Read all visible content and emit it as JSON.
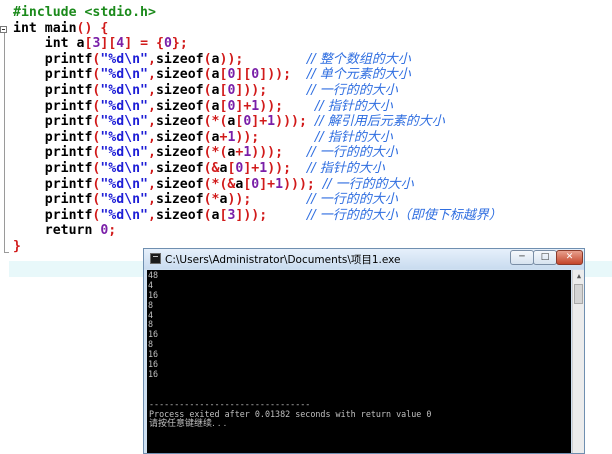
{
  "code_lines": [
    {
      "parts": [
        [
          "pp",
          "#include <stdio.h>"
        ]
      ]
    },
    {
      "parts": [
        [
          "kw",
          "int "
        ],
        [
          "fn",
          "main"
        ],
        [
          "sym",
          "() {"
        ]
      ]
    },
    {
      "parts": [
        [
          "kw",
          "    int "
        ],
        [
          "fn",
          "a"
        ],
        [
          "sym",
          "["
        ],
        [
          "num",
          "3"
        ],
        [
          "sym",
          "]["
        ],
        [
          "num",
          "4"
        ],
        [
          "sym",
          "] = {"
        ],
        [
          "num",
          "0"
        ],
        [
          "sym",
          "};"
        ]
      ]
    },
    {
      "parts": [
        [
          "fn",
          "    printf"
        ],
        [
          "sym",
          "("
        ],
        [
          "str",
          "\"%d\\n\""
        ],
        [
          "sym",
          ","
        ],
        [
          "kw",
          "sizeof"
        ],
        [
          "sym",
          "("
        ],
        [
          "fn",
          "a"
        ],
        [
          "sym",
          "));"
        ],
        [
          "fn",
          "        "
        ],
        [
          "cm",
          "// 整个数组的大小"
        ]
      ]
    },
    {
      "parts": [
        [
          "fn",
          "    printf"
        ],
        [
          "sym",
          "("
        ],
        [
          "str",
          "\"%d\\n\""
        ],
        [
          "sym",
          ","
        ],
        [
          "kw",
          "sizeof"
        ],
        [
          "sym",
          "("
        ],
        [
          "fn",
          "a"
        ],
        [
          "sym",
          "["
        ],
        [
          "num",
          "0"
        ],
        [
          "sym",
          "]["
        ],
        [
          "num",
          "0"
        ],
        [
          "sym",
          "]));"
        ],
        [
          "fn",
          "  "
        ],
        [
          "cm",
          "// 单个元素的大小"
        ]
      ]
    },
    {
      "parts": [
        [
          "fn",
          "    printf"
        ],
        [
          "sym",
          "("
        ],
        [
          "str",
          "\"%d\\n\""
        ],
        [
          "sym",
          ","
        ],
        [
          "kw",
          "sizeof"
        ],
        [
          "sym",
          "("
        ],
        [
          "fn",
          "a"
        ],
        [
          "sym",
          "["
        ],
        [
          "num",
          "0"
        ],
        [
          "sym",
          "]));"
        ],
        [
          "fn",
          "     "
        ],
        [
          "cm",
          "// 一行的的大小"
        ]
      ]
    },
    {
      "parts": [
        [
          "fn",
          "    printf"
        ],
        [
          "sym",
          "("
        ],
        [
          "str",
          "\"%d\\n\""
        ],
        [
          "sym",
          ","
        ],
        [
          "kw",
          "sizeof"
        ],
        [
          "sym",
          "("
        ],
        [
          "fn",
          "a"
        ],
        [
          "sym",
          "["
        ],
        [
          "num",
          "0"
        ],
        [
          "sym",
          "]+"
        ],
        [
          "num",
          "1"
        ],
        [
          "sym",
          "));"
        ],
        [
          "fn",
          "    "
        ],
        [
          "cm",
          "// 指针的大小"
        ]
      ]
    },
    {
      "parts": [
        [
          "fn",
          "    printf"
        ],
        [
          "sym",
          "("
        ],
        [
          "str",
          "\"%d\\n\""
        ],
        [
          "sym",
          ","
        ],
        [
          "kw",
          "sizeof"
        ],
        [
          "sym",
          "(*("
        ],
        [
          "fn",
          "a"
        ],
        [
          "sym",
          "["
        ],
        [
          "num",
          "0"
        ],
        [
          "sym",
          "]+"
        ],
        [
          "num",
          "1"
        ],
        [
          "sym",
          ")));"
        ],
        [
          "fn",
          " "
        ],
        [
          "cm",
          "// 解引用后元素的大小"
        ]
      ]
    },
    {
      "parts": [
        [
          "fn",
          "    printf"
        ],
        [
          "sym",
          "("
        ],
        [
          "str",
          "\"%d\\n\""
        ],
        [
          "sym",
          ","
        ],
        [
          "kw",
          "sizeof"
        ],
        [
          "sym",
          "("
        ],
        [
          "fn",
          "a"
        ],
        [
          "sym",
          "+"
        ],
        [
          "num",
          "1"
        ],
        [
          "sym",
          "));"
        ],
        [
          "fn",
          "       "
        ],
        [
          "cm",
          "// 指针的大小"
        ]
      ]
    },
    {
      "parts": [
        [
          "fn",
          "    printf"
        ],
        [
          "sym",
          "("
        ],
        [
          "str",
          "\"%d\\n\""
        ],
        [
          "sym",
          ","
        ],
        [
          "kw",
          "sizeof"
        ],
        [
          "sym",
          "(*("
        ],
        [
          "fn",
          "a"
        ],
        [
          "sym",
          "+"
        ],
        [
          "num",
          "1"
        ],
        [
          "sym",
          ")));"
        ],
        [
          "fn",
          "   "
        ],
        [
          "cm",
          "// 一行的的大小"
        ]
      ]
    },
    {
      "parts": [
        [
          "fn",
          "    printf"
        ],
        [
          "sym",
          "("
        ],
        [
          "str",
          "\"%d\\n\""
        ],
        [
          "sym",
          ","
        ],
        [
          "kw",
          "sizeof"
        ],
        [
          "sym",
          "(&"
        ],
        [
          "fn",
          "a"
        ],
        [
          "sym",
          "["
        ],
        [
          "num",
          "0"
        ],
        [
          "sym",
          "]+"
        ],
        [
          "num",
          "1"
        ],
        [
          "sym",
          "));"
        ],
        [
          "fn",
          "  "
        ],
        [
          "cm",
          "// 指针的大小"
        ]
      ]
    },
    {
      "parts": [
        [
          "fn",
          "    printf"
        ],
        [
          "sym",
          "("
        ],
        [
          "str",
          "\"%d\\n\""
        ],
        [
          "sym",
          ","
        ],
        [
          "kw",
          "sizeof"
        ],
        [
          "sym",
          "(*(&"
        ],
        [
          "fn",
          "a"
        ],
        [
          "sym",
          "["
        ],
        [
          "num",
          "0"
        ],
        [
          "sym",
          "]+"
        ],
        [
          "num",
          "1"
        ],
        [
          "sym",
          ")));"
        ],
        [
          "fn",
          " "
        ],
        [
          "cm",
          "// 一行的的大小"
        ]
      ]
    },
    {
      "parts": [
        [
          "fn",
          "    printf"
        ],
        [
          "sym",
          "("
        ],
        [
          "str",
          "\"%d\\n\""
        ],
        [
          "sym",
          ","
        ],
        [
          "kw",
          "sizeof"
        ],
        [
          "sym",
          "(*"
        ],
        [
          "fn",
          "a"
        ],
        [
          "sym",
          "));"
        ],
        [
          "fn",
          "       "
        ],
        [
          "cm",
          "// 一行的的大小"
        ]
      ]
    },
    {
      "parts": [
        [
          "fn",
          "    printf"
        ],
        [
          "sym",
          "("
        ],
        [
          "str",
          "\"%d\\n\""
        ],
        [
          "sym",
          ","
        ],
        [
          "kw",
          "sizeof"
        ],
        [
          "sym",
          "("
        ],
        [
          "fn",
          "a"
        ],
        [
          "sym",
          "["
        ],
        [
          "num",
          "3"
        ],
        [
          "sym",
          "]));"
        ],
        [
          "fn",
          "     "
        ],
        [
          "cm",
          "// 一行的的大小（即使下标越界）"
        ]
      ]
    },
    {
      "parts": [
        [
          "kw",
          "    return "
        ],
        [
          "num",
          "0"
        ],
        [
          "sym",
          ";"
        ]
      ]
    },
    {
      "parts": [
        [
          "sym",
          "}"
        ]
      ]
    }
  ],
  "console": {
    "title": "C:\\Users\\Administrator\\Documents\\项目1.exe",
    "btn_min": "─",
    "btn_max": "□",
    "btn_close": "✕",
    "output_lines": [
      "48",
      "4",
      "16",
      "8",
      "4",
      "8",
      "16",
      "8",
      "16",
      "16",
      "16"
    ],
    "separator": "--------------------------------",
    "exit_message": "Process exited after 0.01382 seconds with return value 0",
    "press_key": "请按任意键继续. . ."
  }
}
